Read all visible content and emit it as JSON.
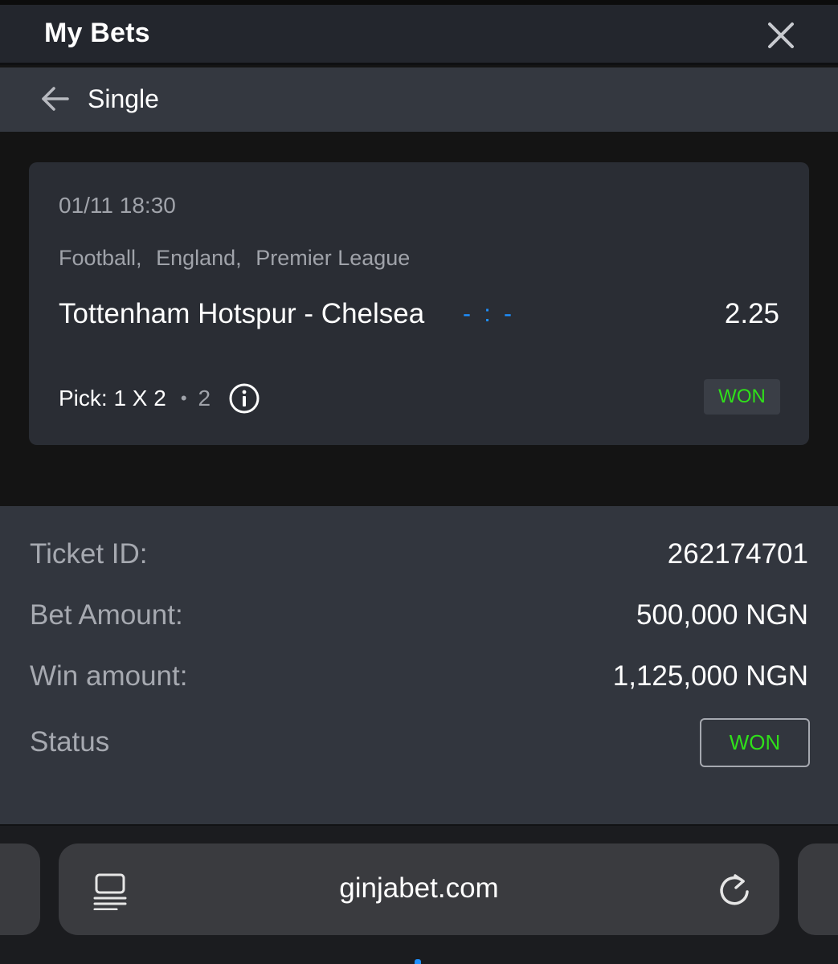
{
  "header": {
    "title": "My Bets",
    "close_icon": "close-icon"
  },
  "subheader": {
    "back_icon": "arrow-left-icon",
    "title": "Single"
  },
  "event": {
    "datetime": "01/11 18:30",
    "category": [
      "Football,",
      "England,",
      "Premier League"
    ],
    "match": "Tottenham Hotspur - Chelsea",
    "score": "- : -",
    "odds": "2.25",
    "pick_label": "Pick: 1 X 2",
    "pick_choice": "2",
    "info_icon": "info-icon",
    "status": "WON"
  },
  "ticket": {
    "rows": [
      {
        "label": "Ticket ID:",
        "value": "262174701"
      },
      {
        "label": "Bet Amount:",
        "value": "500,000 NGN"
      },
      {
        "label": "Win amount:",
        "value": "1,125,000 NGN"
      }
    ],
    "status_label": "Status",
    "status_value": "WON"
  },
  "browser": {
    "url": "ginjabet.com",
    "reader_icon": "reader-mode-icon",
    "reload_icon": "reload-icon"
  },
  "colors": {
    "won_green": "#2fe01a",
    "score_blue": "#1e90ff",
    "card_bg": "#2a2d34",
    "panel_bg": "#32363e"
  }
}
